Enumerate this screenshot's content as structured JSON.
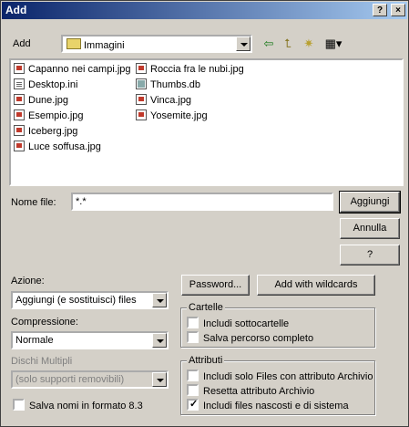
{
  "window": {
    "title": "Add",
    "help_btn": "?",
    "close_btn": "×"
  },
  "lookin": {
    "label": "Add",
    "folder": "Immagini"
  },
  "files_col1": [
    "Capanno nei campi.jpg",
    "Desktop.ini",
    "Dune.jpg",
    "Esempio.jpg",
    "Iceberg.jpg",
    "Luce soffusa.jpg"
  ],
  "files_col2": [
    "Roccia fra le nubi.jpg",
    "Thumbs.db",
    "Vinca.jpg",
    "Yosemite.jpg"
  ],
  "filename": {
    "label": "Nome file:",
    "value": "*.*"
  },
  "buttons": {
    "add": "Aggiungi",
    "cancel": "Annulla",
    "help": "?",
    "password": "Password...",
    "wildcards": "Add with wildcards"
  },
  "action": {
    "label": "Azione:",
    "value": "Aggiungi (e sostituisci) files"
  },
  "compression": {
    "label": "Compressione:",
    "value": "Normale"
  },
  "multi": {
    "label": "Dischi Multipli",
    "value": "(solo supporti removibili)"
  },
  "names83": {
    "label": "Salva nomi in formato 8.3",
    "checked": false
  },
  "folders": {
    "title": "Cartelle",
    "subfolders": {
      "label": "Includi sottocartelle",
      "checked": false
    },
    "fullpath": {
      "label": "Salva percorso completo",
      "checked": false
    }
  },
  "attributes": {
    "title": "Attributi",
    "archive_only": {
      "label": "Includi solo Files con attributo Archivio",
      "checked": false
    },
    "reset_archive": {
      "label": "Resetta attributo Archivio",
      "checked": false
    },
    "hidden_system": {
      "label": "Includi files nascosti e di sistema",
      "checked": true
    }
  }
}
